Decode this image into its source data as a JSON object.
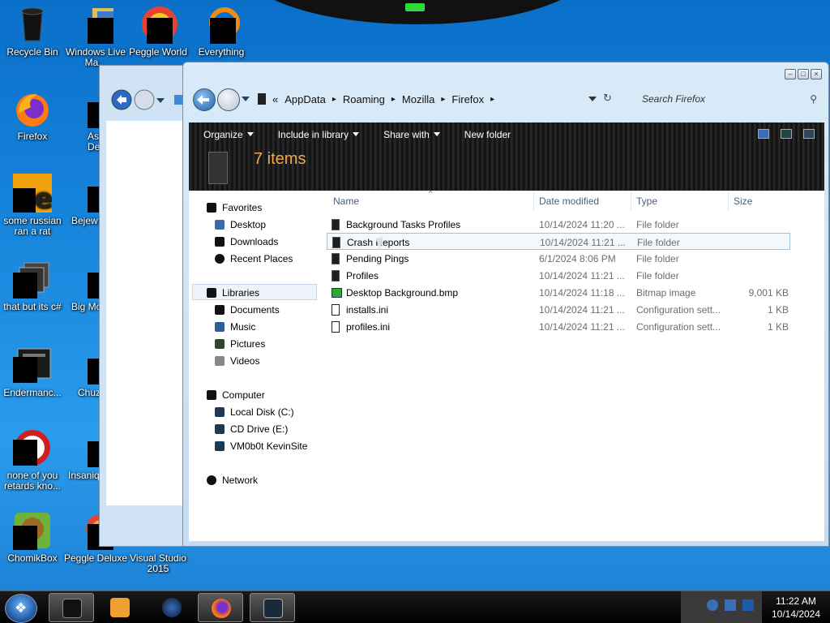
{
  "desktop_icons": [
    {
      "label": "Recycle Bin"
    },
    {
      "label": "Windows Live Ma..."
    },
    {
      "label": "Peggle World"
    },
    {
      "label": "Everything"
    },
    {
      "label": "Firefox"
    },
    {
      "label": "Astro Delu"
    },
    {
      "label": "some russian ran a rat"
    },
    {
      "label": "Bejew Delu"
    },
    {
      "label": "that but its c#"
    },
    {
      "label": "Big Mo Delu"
    },
    {
      "label": "Endermanc..."
    },
    {
      "label": "Chuz Delu"
    },
    {
      "label": "none of you retards kno..."
    },
    {
      "label": "Insaniq Delu"
    },
    {
      "label": "ChomikBox"
    },
    {
      "label": "Peggle Deluxe"
    },
    {
      "label": "Visual Studio 2015"
    }
  ],
  "explorer": {
    "address": {
      "prefix": "«",
      "crumbs": [
        "AppData",
        "Roaming",
        "Mozilla",
        "Firefox"
      ],
      "separator": "▸"
    },
    "search_placeholder": "Search Firefox",
    "toolbar": {
      "organize": "Organize",
      "include_in_library": "Include in library",
      "share_with": "Share with",
      "new_folder": "New folder"
    },
    "items_count": "7 items",
    "nav": {
      "favorites": "Favorites",
      "desktop": "Desktop",
      "downloads": "Downloads",
      "recent_places": "Recent Places",
      "libraries": "Libraries",
      "documents": "Documents",
      "music": "Music",
      "pictures": "Pictures",
      "videos": "Videos",
      "computer": "Computer",
      "local_disk": "Local Disk (C:)",
      "cd_drive": "CD Drive (E:)",
      "vm_site": "VM0b0t KevinSite",
      "network": "Network"
    },
    "columns": {
      "name": "Name",
      "date_modified": "Date modified",
      "type": "Type",
      "size": "Size"
    },
    "files": [
      {
        "name": "Background Tasks Profiles",
        "date": "10/14/2024 11:20 ...",
        "type": "File folder",
        "size": ""
      },
      {
        "name": "Crash Reports",
        "date": "10/14/2024 11:21 ...",
        "type": "File folder",
        "size": ""
      },
      {
        "name": "Pending Pings",
        "date": "6/1/2024 8:06 PM",
        "type": "File folder",
        "size": ""
      },
      {
        "name": "Profiles",
        "date": "10/14/2024 11:21 ...",
        "type": "File folder",
        "size": ""
      },
      {
        "name": "Desktop Background.bmp",
        "date": "10/14/2024 11:18 ...",
        "type": "Bitmap image",
        "size": "9,001 KB"
      },
      {
        "name": "installs.ini",
        "date": "10/14/2024 11:21 ...",
        "type": "Configuration sett...",
        "size": "1 KB"
      },
      {
        "name": "profiles.ini",
        "date": "10/14/2024 11:21 ...",
        "type": "Configuration sett...",
        "size": "1 KB"
      }
    ]
  },
  "taskbar": {
    "time": "11:22 AM",
    "date": "10/14/2024"
  }
}
